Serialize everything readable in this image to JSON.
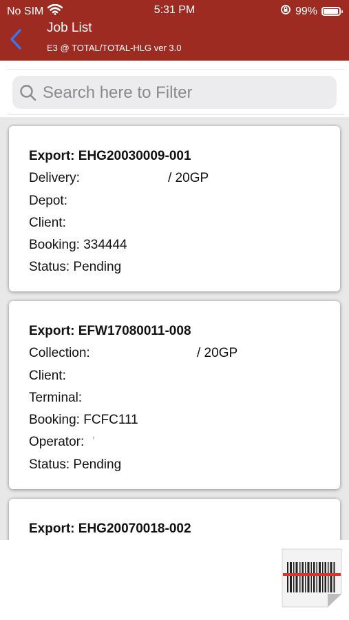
{
  "status_bar": {
    "carrier": "No SIM",
    "time": "5:31 PM",
    "battery": "99%"
  },
  "header": {
    "title": "Job List",
    "subtitle": "E3 @ TOTAL/TOTAL-HLG ver 3.0"
  },
  "search": {
    "placeholder": "Search here to Filter",
    "value": ""
  },
  "jobs": [
    {
      "title": "Export: EHG20030009-001",
      "fields": [
        {
          "label": "Delivery:",
          "value": "/ 20GP"
        },
        {
          "label": "Depot:",
          "value": ""
        },
        {
          "label": "Client:",
          "value": ""
        },
        {
          "label": "Booking: 334444",
          "value": ""
        },
        {
          "label": "Status: Pending",
          "value": ""
        }
      ]
    },
    {
      "title": "Export: EFW17080011-008",
      "fields": [
        {
          "label": "Collection:",
          "value": "/ 20GP"
        },
        {
          "label": "Client:",
          "value": ""
        },
        {
          "label": "Terminal:",
          "value": ""
        },
        {
          "label": "Booking: FCFC111",
          "value": ""
        },
        {
          "label": "Operator:",
          "value": "'"
        },
        {
          "label": "Status: Pending",
          "value": ""
        }
      ]
    },
    {
      "title": "Export: EHG20070018-002",
      "fields": []
    }
  ],
  "colors": {
    "header_bg": "#9e2b22",
    "back_arrow": "#3478f6",
    "barcode_scan_line": "#e0322b"
  },
  "icons": {
    "back": "chevron-left-icon",
    "search": "search-icon",
    "wifi": "wifi-icon",
    "battery": "battery-icon",
    "orientation_lock": "orientation-lock-icon",
    "barcode": "barcode-scan-icon"
  }
}
